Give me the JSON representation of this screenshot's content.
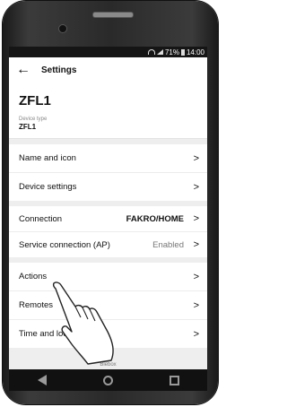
{
  "statusbar": {
    "battery": "71%",
    "time": "14:00"
  },
  "appbar": {
    "back_icon": "arrow-left-icon",
    "title": "Settings"
  },
  "device": {
    "name": "ZFL1",
    "type_label": "Device type",
    "type_value": "ZFL1"
  },
  "group1": [
    {
      "label": "Name and icon"
    },
    {
      "label": "Device settings"
    }
  ],
  "group2": [
    {
      "label": "Connection",
      "value": "FAKRO/HOME"
    },
    {
      "label": "Service connection (AP)",
      "value": "Enabled"
    }
  ],
  "group3": [
    {
      "label": "Actions"
    },
    {
      "label": "Remotes"
    },
    {
      "label": "Time and location"
    }
  ],
  "footer": {
    "text": "Blebox"
  },
  "chevron": ">",
  "nav": {
    "back_icon": "triangle-back-icon",
    "home_icon": "circle-home-icon",
    "recent_icon": "square-recents-icon"
  }
}
